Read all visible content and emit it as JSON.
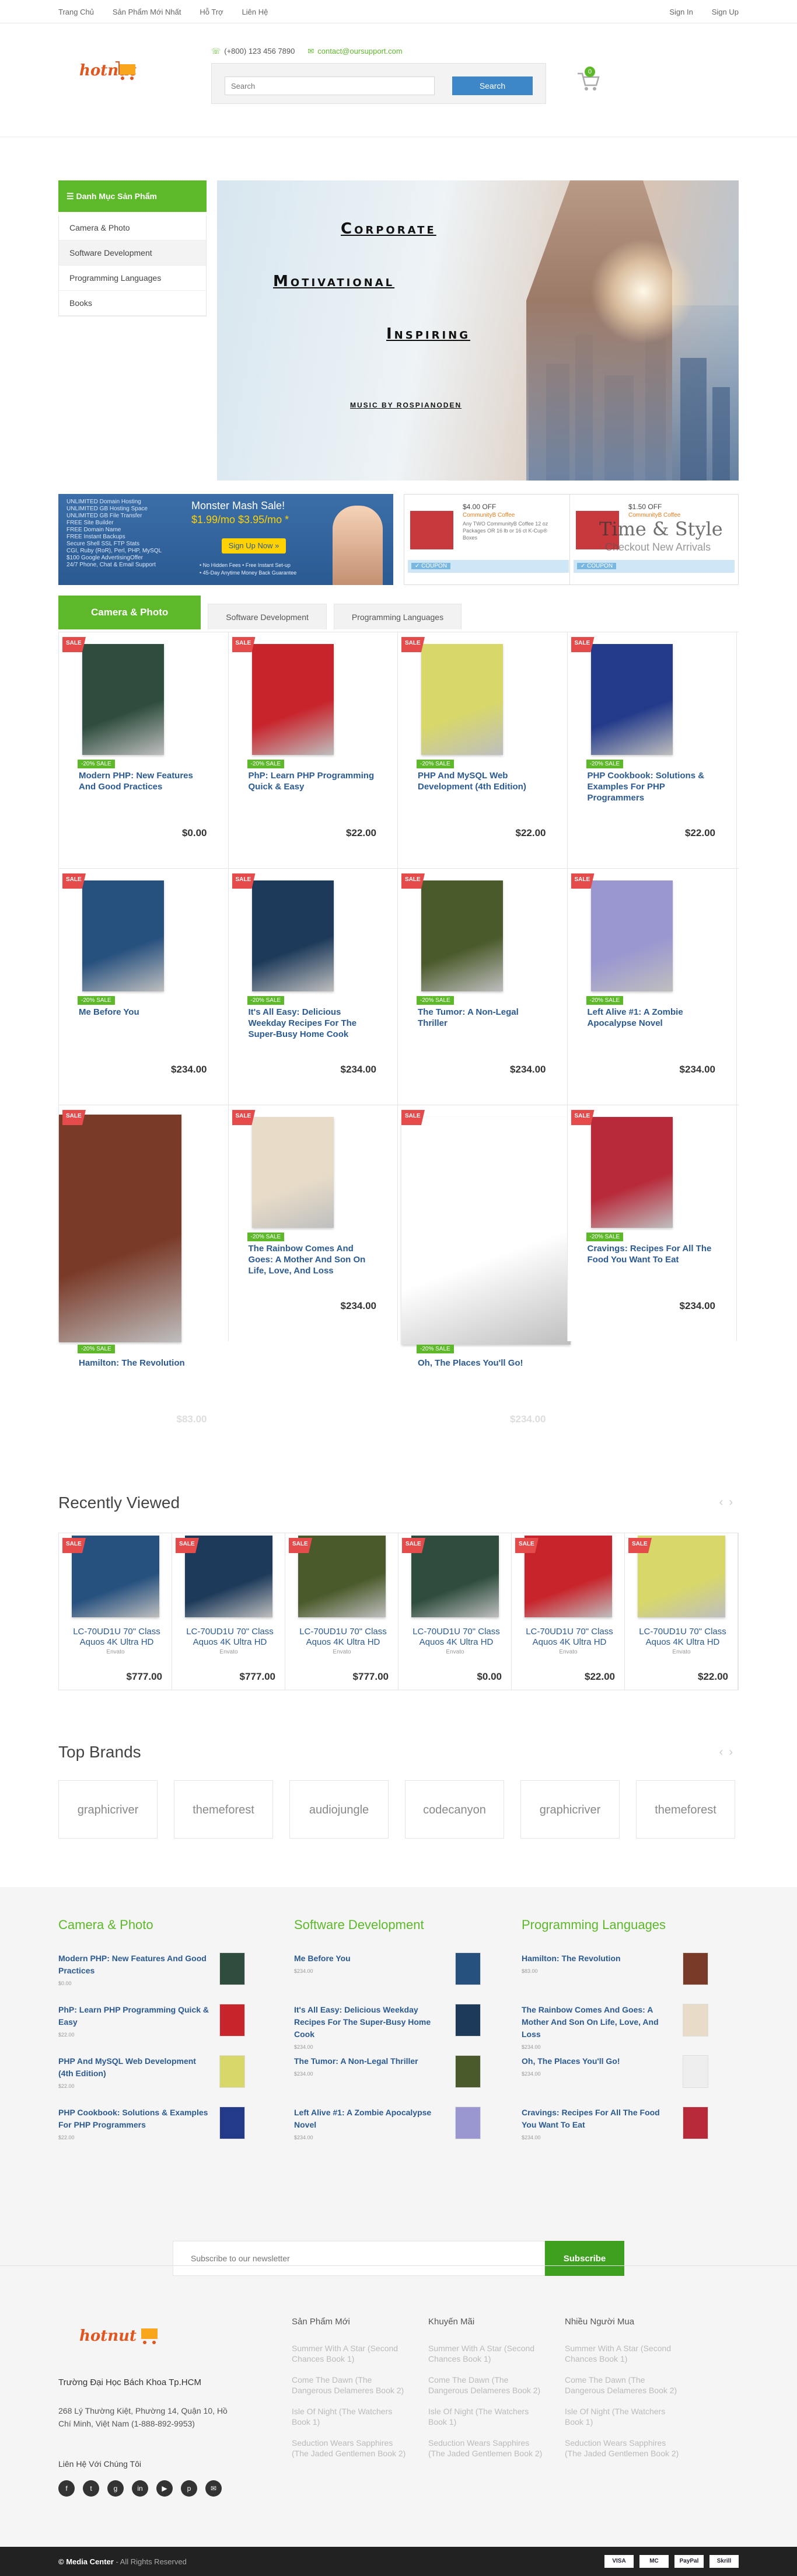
{
  "topbar": {
    "nav": [
      "Trang Chủ",
      "Sản Phẩm Mới Nhất",
      "Hỗ Trợ",
      "Liên Hệ"
    ],
    "signin": "Sign In",
    "signup": "Sign Up"
  },
  "header": {
    "logo": {
      "part1": "hotnut",
      "part2": "i"
    },
    "phone": "(+800) 123 456 7890",
    "email": "contact@oursupport.com",
    "search_placeholder": "Search",
    "search_button": "Search",
    "cart_count": "0"
  },
  "categories": {
    "title": "Danh Mục Sản Phẩm",
    "items": [
      "Camera & Photo",
      "Software Development",
      "Programming Languages",
      "Books"
    ]
  },
  "banner": {
    "line1": "Corporate",
    "line2": "Motivational",
    "line3": "Inspiring",
    "credit": "MUSIC BY ROSPIANODEN"
  },
  "ads": {
    "ad1": {
      "title": "Monster Mash Sale!",
      "price": "$1.99/mo  $3.95/mo *",
      "button": "Sign Up Now »",
      "features": "UNLIMITED Domain Hosting\nUNLIMITED GB Hosting Space\nUNLIMITED GB File Transfer\nFREE Site Builder\nFREE Domain Name\nFREE Instant Backups\nSecure Shell SSL FTP Stats\nCGI, Ruby (RoR), Perl, PHP, MySQL\n$100 Google AdvertisingOffer\n24/7 Phone, Chat & Email Support",
      "notes": "• No Hidden Fees   • Free Instant Set-up\n• 45-Day Anytime Money Back Guarantee"
    },
    "ad2": {
      "off": "$4.00 OFF",
      "sub": "CommunityB Coffee",
      "desc": "Any TWO CommunityB Coffee 12 oz Packages OR 16 lb or 16 ct K-Cup® Boxes",
      "coupon": "✓ COUPON"
    },
    "ad3": {
      "off": "$1.50 OFF",
      "sub": "CommunityB Coffee",
      "desc": "Accept Any...",
      "overlay": "Time & Style",
      "overlay2": "Checkout New Arrivals",
      "coupon": "✓ COUPON"
    }
  },
  "tabs": [
    "Camera & Photo",
    "Software Development",
    "Programming Languages"
  ],
  "products": [
    {
      "title": "Modern PHP: New Features And Good Practices",
      "price": "$0.00",
      "sale": "SALE",
      "discount": "-20% SALE",
      "color": "#2e4d3e"
    },
    {
      "title": "PhP: Learn PHP Programming Quick & Easy",
      "price": "$22.00",
      "sale": "SALE",
      "discount": "-20% SALE",
      "color": "#c8242b"
    },
    {
      "title": "PHP And MySQL Web Development (4th Edition)",
      "price": "$22.00",
      "sale": "SALE",
      "discount": "-20% SALE",
      "color": "#d8d86a"
    },
    {
      "title": "PHP Cookbook: Solutions & Examples For PHP Programmers",
      "price": "$22.00",
      "sale": "SALE",
      "discount": "-20% SALE",
      "color": "#233a8a"
    },
    {
      "title": "Me Before You",
      "price": "$234.00",
      "sale": "SALE",
      "discount": "-20% SALE",
      "color": "#26507e"
    },
    {
      "title": "It's All Easy: Delicious Weekday Recipes For The Super-Busy Home Cook",
      "price": "$234.00",
      "sale": "SALE",
      "discount": "-20% SALE",
      "color": "#1d3a5a"
    },
    {
      "title": "The Tumor: A Non-Legal Thriller",
      "price": "$234.00",
      "sale": "SALE",
      "discount": "-20% SALE",
      "color": "#4a5a2a"
    },
    {
      "title": "Left Alive #1: A Zombie Apocalypse Novel",
      "price": "$234.00",
      "sale": "SALE",
      "discount": "-20% SALE",
      "color": "#9a97d0"
    },
    {
      "title": "Hamilton: The Revolution",
      "price": "$83.00",
      "sale": "SALE",
      "discount": "-20% SALE",
      "color": "#7a3a28"
    },
    {
      "title": "The Rainbow Comes And Goes: A Mother And Son On Life, Love, And Loss",
      "price": "$234.00",
      "sale": "SALE",
      "discount": "-20% SALE",
      "color": "#e8dcc8"
    },
    {
      "title": "Oh, The Places You'll Go!",
      "price": "$234.00",
      "sale": "SALE",
      "discount": "-20% SALE",
      "color": "#ffffff"
    },
    {
      "title": "Cravings: Recipes For All The Food You Want To Eat",
      "price": "$234.00",
      "sale": "SALE",
      "discount": "-20% SALE",
      "color": "#b82a3a"
    }
  ],
  "recently_viewed": {
    "title": "Recently Viewed",
    "items": [
      {
        "title": "LC-70UD1U 70\" Class Aquos 4K Ultra HD",
        "brand": "Envato",
        "price": "$777.00",
        "color": "#26507e"
      },
      {
        "title": "LC-70UD1U 70\" Class Aquos 4K Ultra HD",
        "brand": "Envato",
        "price": "$777.00",
        "color": "#1d3a5a"
      },
      {
        "title": "LC-70UD1U 70\" Class Aquos 4K Ultra HD",
        "brand": "Envato",
        "price": "$777.00",
        "color": "#4a5a2a"
      },
      {
        "title": "LC-70UD1U 70\" Class Aquos 4K Ultra HD",
        "brand": "Envato",
        "price": "$0.00",
        "color": "#2e4d3e"
      },
      {
        "title": "LC-70UD1U 70\" Class Aquos 4K Ultra HD",
        "brand": "Envato",
        "price": "$22.00",
        "color": "#c8242b"
      },
      {
        "title": "LC-70UD1U 70\" Class Aquos 4K Ultra HD",
        "brand": "Envato",
        "price": "$22.00",
        "color": "#d8d86a"
      }
    ]
  },
  "brands": {
    "title": "Top Brands",
    "items": [
      "graphicriver",
      "themeforest",
      "audiojungle",
      "codecanyon",
      "graphicriver",
      "themeforest"
    ]
  },
  "footer_lists": [
    {
      "title": "Camera & Photo",
      "items": [
        {
          "title": "Modern PHP: New Features And Good Practices",
          "price": "$0.00",
          "color": "#2e4d3e"
        },
        {
          "title": "PhP: Learn PHP Programming Quick & Easy",
          "price": "$22.00",
          "color": "#c8242b"
        },
        {
          "title": "PHP And MySQL Web Development (4th Edition)",
          "price": "$22.00",
          "color": "#d8d86a"
        },
        {
          "title": "PHP Cookbook: Solutions & Examples For PHP Programmers",
          "price": "$22.00",
          "color": "#233a8a"
        }
      ]
    },
    {
      "title": "Software Development",
      "items": [
        {
          "title": "Me Before You",
          "price": "$234.00",
          "color": "#26507e"
        },
        {
          "title": "It's All Easy: Delicious Weekday Recipes For The Super-Busy Home Cook",
          "price": "$234.00",
          "color": "#1d3a5a"
        },
        {
          "title": "The Tumor: A Non-Legal Thriller",
          "price": "$234.00",
          "color": "#4a5a2a"
        },
        {
          "title": "Left Alive #1: A Zombie Apocalypse Novel",
          "price": "$234.00",
          "color": "#9a97d0"
        }
      ]
    },
    {
      "title": "Programming Languages",
      "items": [
        {
          "title": "Hamilton: The Revolution",
          "price": "$83.00",
          "color": "#7a3a28"
        },
        {
          "title": "The Rainbow Comes And Goes: A Mother And Son On Life, Love, And Loss",
          "price": "$234.00",
          "color": "#e8dcc8"
        },
        {
          "title": "Oh, The Places You'll Go!",
          "price": "$234.00",
          "color": "#eeeeee"
        },
        {
          "title": "Cravings: Recipes For All The Food You Want To Eat",
          "price": "$234.00",
          "color": "#b82a3a"
        }
      ]
    }
  ],
  "newsletter": {
    "placeholder": "Subscribe to our newsletter",
    "button": "Subscribe"
  },
  "footer": {
    "name": "Trường Đại Học Bách Khoa Tp.HCM",
    "address": "268 Lý Thường Kiệt, Phường 14, Quận 10, Hồ Chí Minh, Việt Nam (1-888-892-9953)",
    "connect": "Liên Hệ Với Chúng Tôi",
    "social": [
      "f",
      "t",
      "g",
      "in",
      "▶",
      "p",
      "✉"
    ],
    "cols": [
      {
        "title": "Sản Phẩm Mới",
        "links": [
          "Summer With A Star (Second Chances Book 1)",
          "Come The Dawn (The Dangerous Delameres Book 2)",
          "Isle Of Night (The Watchers Book 1)",
          "Seduction Wears Sapphires (The Jaded Gentlemen Book 2)"
        ]
      },
      {
        "title": "Khuyến Mãi",
        "links": [
          "Summer With A Star (Second Chances Book 1)",
          "Come The Dawn (The Dangerous Delameres Book 2)",
          "Isle Of Night (The Watchers Book 1)",
          "Seduction Wears Sapphires (The Jaded Gentlemen Book 2)"
        ]
      },
      {
        "title": "Nhiều Người Mua",
        "links": [
          "Summer With A Star (Second Chances Book 1)",
          "Come The Dawn (The Dangerous Delameres Book 2)",
          "Isle Of Night (The Watchers Book 1)",
          "Seduction Wears Sapphires (The Jaded Gentlemen Book 2)"
        ]
      }
    ],
    "copyright_brand": "© Media Center",
    "copyright_rest": " - All Rights Reserved",
    "payments": [
      "VISA",
      "MC",
      "PayPal",
      "Skrill"
    ]
  },
  "colors": {
    "accent": "#5db82a",
    "link": "#2b5a92",
    "sale": "#e64b4b",
    "search": "#3d86c7"
  }
}
